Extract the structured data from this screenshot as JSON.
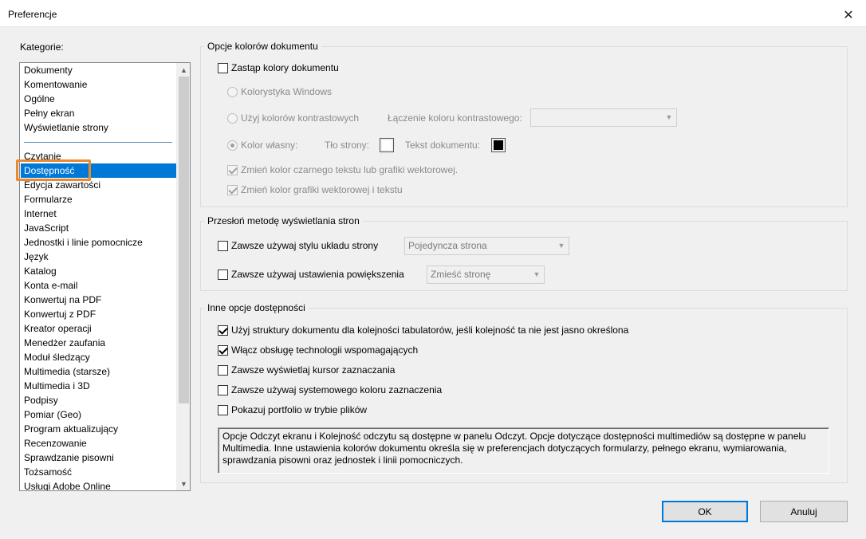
{
  "window": {
    "title": "Preferencje"
  },
  "categories": {
    "label": "Kategorie:",
    "group1": [
      "Dokumenty",
      "Komentowanie",
      "Ogólne",
      "Pełny ekran",
      "Wyświetlanie strony"
    ],
    "group2": [
      "Czytanie",
      "Dostępność",
      "Edycja zawartości",
      "Formularze",
      "Internet",
      "JavaScript",
      "Jednostki i linie pomocnicze",
      "Język",
      "Katalog",
      "Konta e-mail",
      "Konwertuj na PDF",
      "Konwertuj z PDF",
      "Kreator operacji",
      "Menedżer zaufania",
      "Moduł śledzący",
      "Multimedia (starsze)",
      "Multimedia i 3D",
      "Podpisy",
      "Pomiar (Geo)",
      "Program aktualizujący",
      "Recenzowanie",
      "Sprawdzanie pisowni",
      "Tożsamość",
      "Usługi Adobe Online"
    ],
    "selected": "Dostępność"
  },
  "doc_colors": {
    "title": "Opcje kolorów dokumentu",
    "replace_colors": "Zastąp kolory dokumentu",
    "windows_scheme": "Kolorystyka Windows",
    "high_contrast": "Użyj kolorów kontrastowych",
    "contrast_combo_label": "Łączenie koloru kontrastowego:",
    "contrast_combo_value": "",
    "custom_color": "Kolor własny:",
    "page_bg_label": "Tło strony:",
    "doc_text_label": "Tekst dokumentu:",
    "page_bg_color": "#ffffff",
    "doc_text_color": "#000000",
    "change_black_text": "Zmień kolor czarnego tekstu lub grafiki wektorowej.",
    "change_vector": "Zmień kolor grafiki wektorowej i tekstu"
  },
  "override_view": {
    "title": "Przesłoń metodę wyświetlania stron",
    "page_layout_label": "Zawsze używaj stylu układu strony",
    "page_layout_value": "Pojedyncza strona",
    "zoom_label": "Zawsze używaj ustawienia powiększenia",
    "zoom_value": "Zmieść stronę"
  },
  "other": {
    "title": "Inne opcje dostępności",
    "tab_order": "Użyj struktury dokumentu dla kolejności tabulatorów, jeśli kolejność ta nie jest jasno określona",
    "assistive_tech": "Włącz obsługę technologii wspomagających",
    "show_cursor": "Zawsze wyświetlaj kursor zaznaczania",
    "system_selection": "Zawsze używaj systemowego koloru zaznaczenia",
    "portfolio_files": "Pokazuj portfolio w trybie plików",
    "info_text": "Opcje Odczyt ekranu i Kolejność odczytu są dostępne w panelu Odczyt. Opcje dotyczące dostępności multimediów są dostępne w panelu Multimedia. Inne ustawienia kolorów dokumentu określa się w preferencjach dotyczących formularzy, pełnego ekranu, wymiarowania, sprawdzania pisowni oraz jednostek i linii pomocniczych."
  },
  "buttons": {
    "ok": "OK",
    "cancel": "Anuluj"
  }
}
